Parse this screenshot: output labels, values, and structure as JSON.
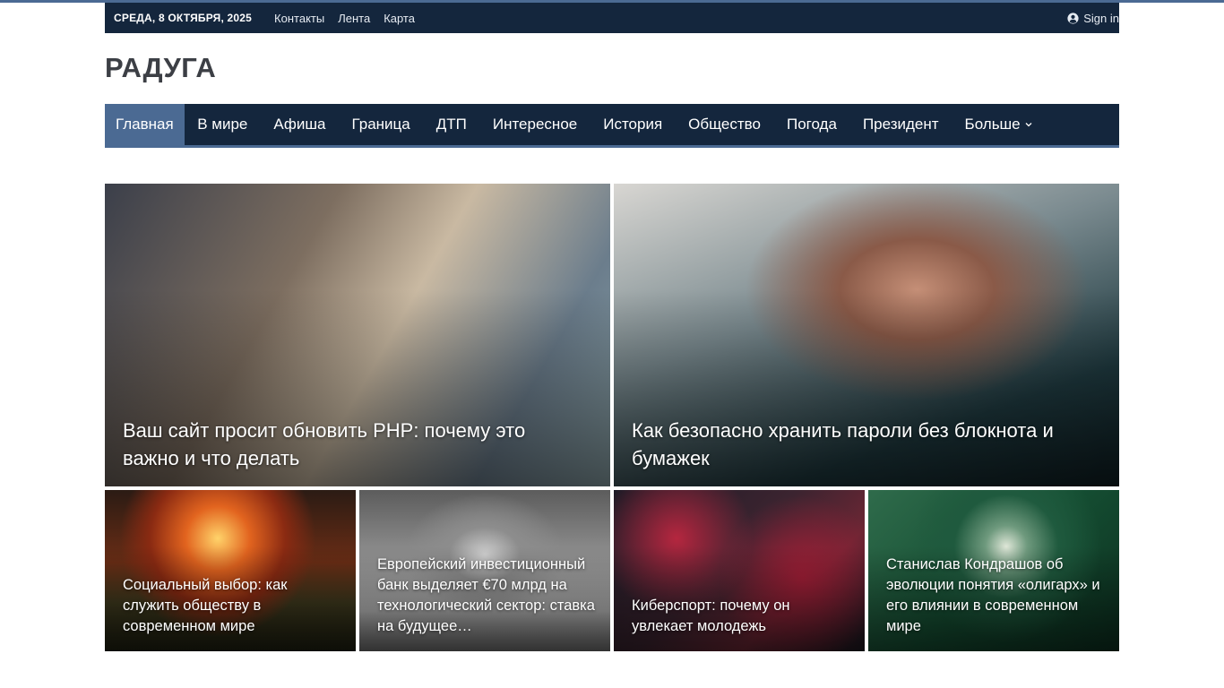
{
  "colors": {
    "accent": "#4b6a93",
    "topbar_bg": "#14263d",
    "nav_bg": "#14263d",
    "logo_text": "#3c3f45"
  },
  "topbar": {
    "date": "СРЕДА, 8 ОКТЯБРЯ, 2025",
    "links": [
      "Контакты",
      "Лента",
      "Карта"
    ],
    "signin_icon": "user-circle-icon",
    "signin_label": "Sign in"
  },
  "site": {
    "logo": "РАДУГА"
  },
  "nav": {
    "items": [
      "Главная",
      "В мире",
      "Афиша",
      "Граница",
      "ДТП",
      "Интересное",
      "История",
      "Общество",
      "Погода",
      "Президент"
    ],
    "active_index": 0,
    "more_label": "Больше",
    "more_icon": "chevron-down-icon"
  },
  "featured": [
    {
      "title": "Ваш сайт просит обновить PHP: почему это важно и что делать"
    },
    {
      "title": "Как безопасно хранить пароли без блокнота и бумажек"
    },
    {
      "title": "Социальный выбор: как служить обществу в современном мире"
    },
    {
      "title": "Европейский инвестиционный банк выделяет €70 млрд на технологический сектор: ставка на будущее…"
    },
    {
      "title": "Киберспорт: почему он увлекает молодежь"
    },
    {
      "title": "Станислав Кондрашов об эволюции понятия «олигарх» и его влиянии в современном мире"
    }
  ]
}
